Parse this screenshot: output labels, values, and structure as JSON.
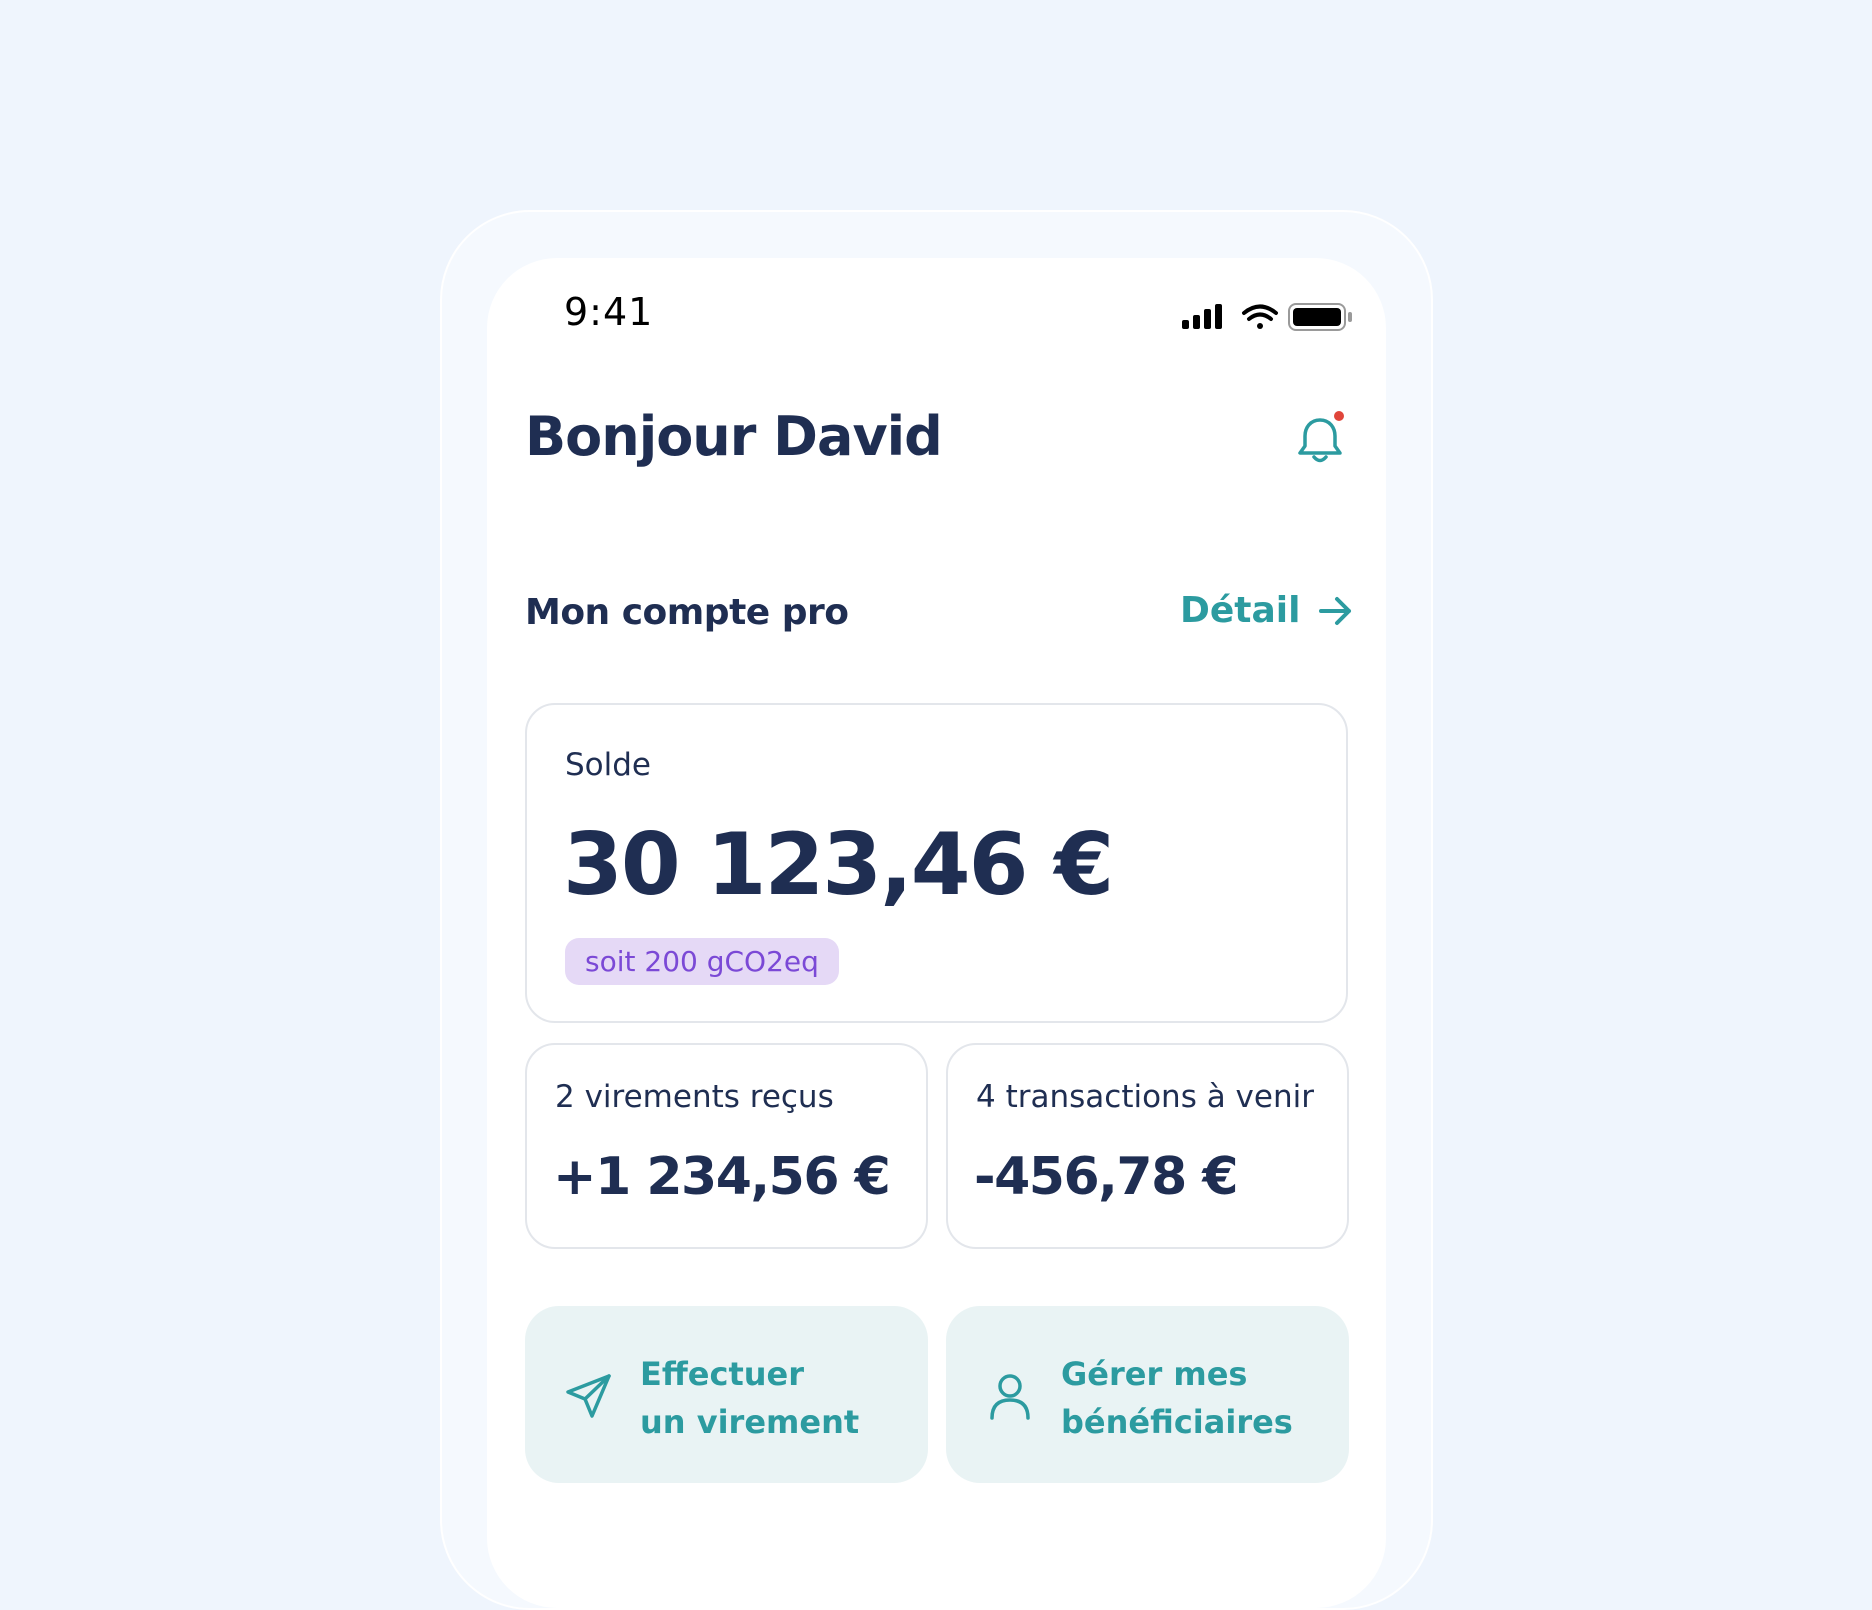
{
  "status_bar": {
    "time": "9:41",
    "icons": [
      "cellular-signal-icon",
      "wifi-icon",
      "battery-icon"
    ]
  },
  "header": {
    "greeting": "Bonjour David",
    "notification_icon": "bell-icon",
    "has_unread": true
  },
  "account": {
    "title": "Mon compte pro",
    "detail_label": "Détail",
    "detail_icon": "arrow-right-icon"
  },
  "balance": {
    "label": "Solde",
    "amount": "30 123,46 €",
    "co2_badge": "soit 200 gCO2eq"
  },
  "stats": {
    "received": {
      "label": "2 virements reçus",
      "value": "+1 234,56 €"
    },
    "upcoming": {
      "label": "4 transactions à venir",
      "value": "-456,78 €"
    }
  },
  "actions": {
    "transfer": {
      "line1": "Effectuer",
      "line2": "un virement",
      "icon": "send-icon"
    },
    "beneficiaries": {
      "line1": "Gérer mes",
      "line2": "bénéficiaires",
      "icon": "user-icon"
    }
  },
  "colors": {
    "background": "#eff5fd",
    "text_primary": "#1f2e52",
    "accent": "#2c9ba0",
    "badge_bg": "#e5d9f6",
    "badge_text": "#7b49d6",
    "action_bg": "#e9f3f4",
    "notification_dot": "#e0453a"
  }
}
